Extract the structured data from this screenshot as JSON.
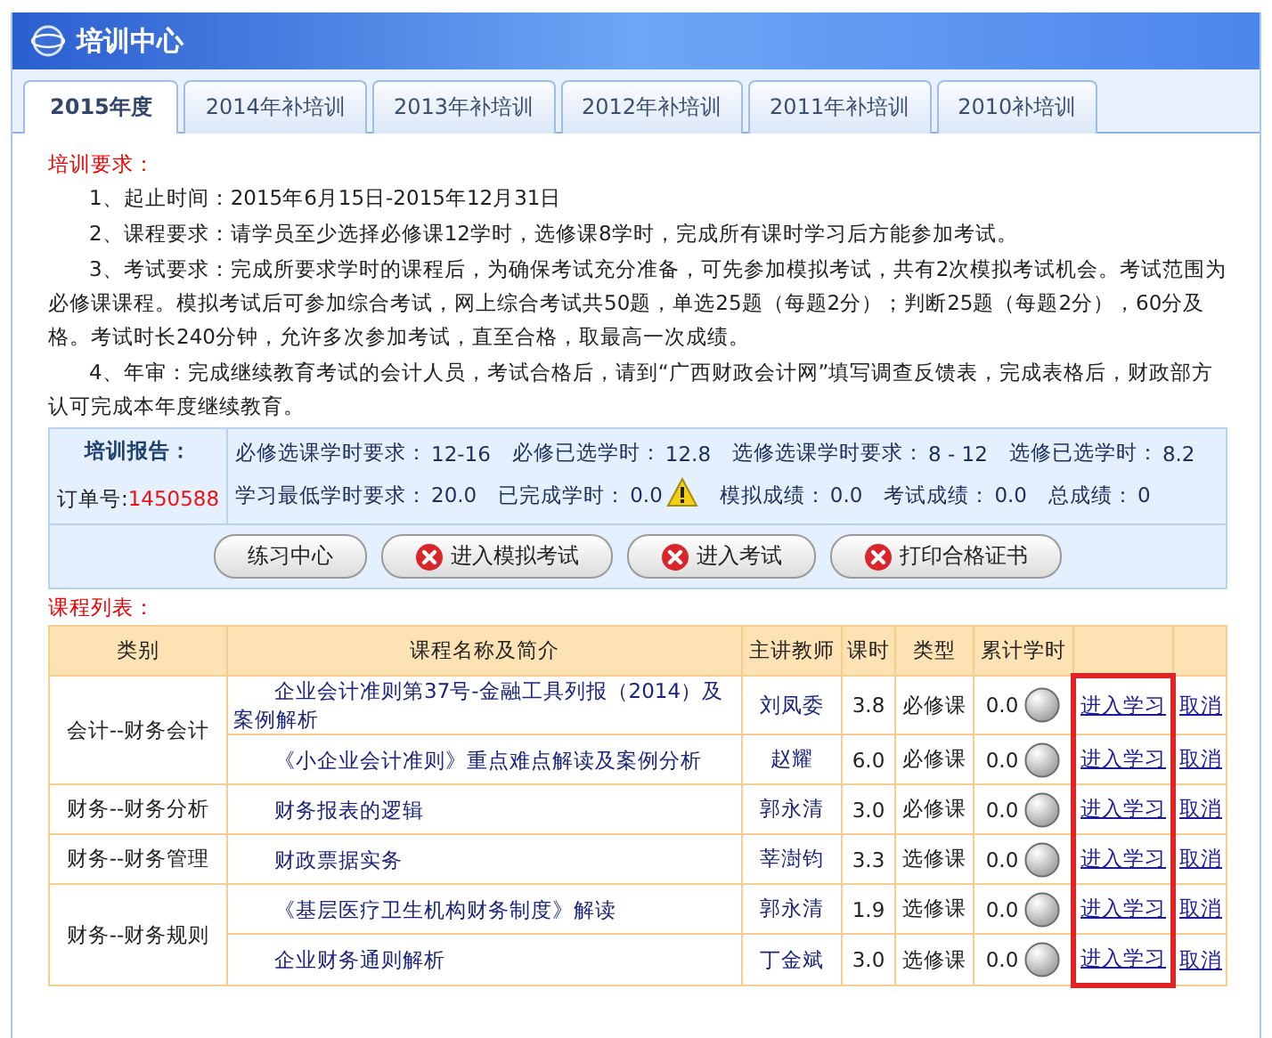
{
  "window": {
    "title": "培训中心"
  },
  "tabs": [
    {
      "label": "2015年度",
      "selected": true
    },
    {
      "label": "2014年补培训",
      "selected": false
    },
    {
      "label": "2013年补培训",
      "selected": false
    },
    {
      "label": "2012年补培训",
      "selected": false
    },
    {
      "label": "2011年补培训",
      "selected": false
    },
    {
      "label": "2010补培训",
      "selected": false
    }
  ],
  "requirements": {
    "heading": "培训要求：",
    "items": [
      "1、起止时间：2015年6月15日-2015年12月31日",
      "2、课程要求：请学员至少选择必修课12学时，选修课8学时，完成所有课时学习后方能参加考试。",
      "3、考试要求：完成所要求学时的课程后，为确保考试充分准备，可先参加模拟考试，共有2次模拟考试机会。考试范围为必修课课程。模拟考试后可参加综合考试，网上综合考试共50题，单选25题（每题2分）；判断25题（每题2分），60分及格。考试时长240分钟，允许多次参加考试，直至合格，取最高一次成绩。",
      "4、年审：完成继续教育考试的会计人员，考试合格后，请到“广西财政会计网”填写调查反馈表，完成表格后，财政部方认可完成本年度继续教育。"
    ]
  },
  "report": {
    "heading": "培训报告：",
    "order_label": "订单号:",
    "order_number": "1450588",
    "stats": [
      [
        {
          "label": "必修选课学时要求：",
          "value": "12-16"
        },
        {
          "label": "必修已选学时：",
          "value": "12.8"
        },
        {
          "label": "选修选课学时要求：",
          "value": "8 - 12"
        },
        {
          "label": "选修已选学时：",
          "value": "8.2"
        }
      ],
      [
        {
          "label": "学习最低学时要求：",
          "value": "20.0"
        },
        {
          "label": "已完成学时：",
          "value": "0.0",
          "warning": true
        },
        {
          "label": "模拟成绩：",
          "value": "0.0"
        },
        {
          "label": "考试成绩：",
          "value": "0.0"
        },
        {
          "label": "总成绩：",
          "value": "0"
        }
      ]
    ]
  },
  "buttons": [
    {
      "label": "练习中心",
      "kind": "plain"
    },
    {
      "label": "进入模拟考试",
      "kind": "blocked"
    },
    {
      "label": "进入考试",
      "kind": "blocked"
    },
    {
      "label": "打印合格证书",
      "kind": "blocked"
    }
  ],
  "course_list": {
    "heading": "课程列表：",
    "columns": [
      "类别",
      "课程名称及简介",
      "主讲教师",
      "课时",
      "类型",
      "累计学时"
    ],
    "groups": [
      {
        "category": "会计--财务会计",
        "courses": [
          {
            "name": "企业会计准则第37号-金融工具列报（2014）及案例解析",
            "teacher": "刘凤委",
            "hours": "3.8",
            "type": "必修课",
            "accumulated": "0.0",
            "study": "进入学习",
            "cancel": "取消",
            "highlighted": true
          },
          {
            "name": "《小企业会计准则》重点难点解读及案例分析",
            "teacher": "赵耀",
            "hours": "6.0",
            "type": "必修课",
            "accumulated": "0.0",
            "study": "进入学习",
            "cancel": "取消",
            "highlighted": true
          }
        ]
      },
      {
        "category": "财务--财务分析",
        "courses": [
          {
            "name": "财务报表的逻辑",
            "teacher": "郭永清",
            "hours": "3.0",
            "type": "必修课",
            "accumulated": "0.0",
            "study": "进入学习",
            "cancel": "取消",
            "highlighted": true
          }
        ]
      },
      {
        "category": "财务--财务管理",
        "courses": [
          {
            "name": "财政票据实务",
            "teacher": "莘澍钧",
            "hours": "3.3",
            "type": "选修课",
            "accumulated": "0.0",
            "study": "进入学习",
            "cancel": "取消",
            "highlighted": true
          }
        ]
      },
      {
        "category": "财务--财务规则",
        "courses": [
          {
            "name": "《基层医疗卫生机构财务制度》解读",
            "teacher": "郭永清",
            "hours": "1.9",
            "type": "选修课",
            "accumulated": "0.0",
            "study": "进入学习",
            "cancel": "取消",
            "highlighted": true
          },
          {
            "name": "企业财务通则解析",
            "teacher": "丁金斌",
            "hours": "3.0",
            "type": "选修课",
            "accumulated": "0.0",
            "study": "进入学习",
            "cancel": "取消",
            "highlighted": true
          }
        ]
      }
    ]
  }
}
